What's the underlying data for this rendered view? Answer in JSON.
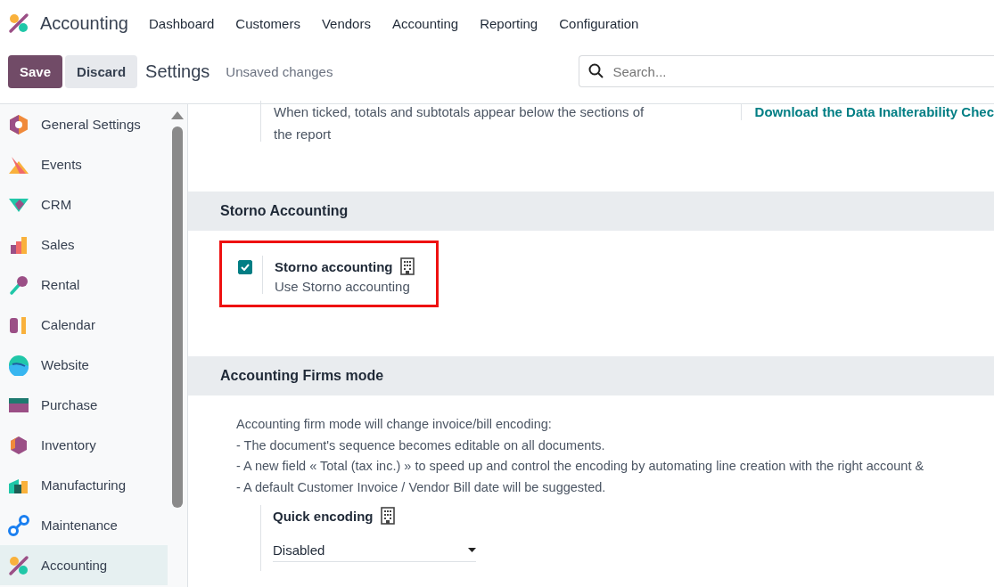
{
  "navbar": {
    "app_name": "Accounting",
    "menu": [
      "Dashboard",
      "Customers",
      "Vendors",
      "Accounting",
      "Reporting",
      "Configuration"
    ]
  },
  "control_bar": {
    "save": "Save",
    "discard": "Discard",
    "title": "Settings",
    "status": "Unsaved changes",
    "search": {
      "placeholder": "Search..."
    }
  },
  "sidebar": {
    "items": [
      {
        "label": "General Settings",
        "selected": false
      },
      {
        "label": "Events",
        "selected": false
      },
      {
        "label": "CRM",
        "selected": false
      },
      {
        "label": "Sales",
        "selected": false
      },
      {
        "label": "Rental",
        "selected": false
      },
      {
        "label": "Calendar",
        "selected": false
      },
      {
        "label": "Website",
        "selected": false
      },
      {
        "label": "Purchase",
        "selected": false
      },
      {
        "label": "Inventory",
        "selected": false
      },
      {
        "label": "Manufacturing",
        "selected": false
      },
      {
        "label": "Maintenance",
        "selected": false
      },
      {
        "label": "Accounting",
        "selected": true
      }
    ]
  },
  "top_partial": {
    "description": "When ticked, totals and subtotals appear below the sections of the report",
    "link": "Download the Data Inalterability Chec"
  },
  "sections": [
    {
      "title": "Storno Accounting",
      "kind": "checkbox",
      "setting": {
        "label": "Storno accounting",
        "description": "Use Storno accounting",
        "checked": true,
        "highlighted": true
      }
    },
    {
      "title": "Accounting Firms mode",
      "kind": "select",
      "lines": [
        "Accounting firm mode will change invoice/bill encoding:",
        "- The document's sequence becomes editable on all documents.",
        "- A new field « Total (tax inc.) » to speed up and control the encoding by automating line creation with the right account &",
        "- A default Customer Invoice / Vendor Bill date will be suggested."
      ],
      "setting": {
        "label": "Quick encoding",
        "value": "Disabled"
      }
    }
  ]
}
